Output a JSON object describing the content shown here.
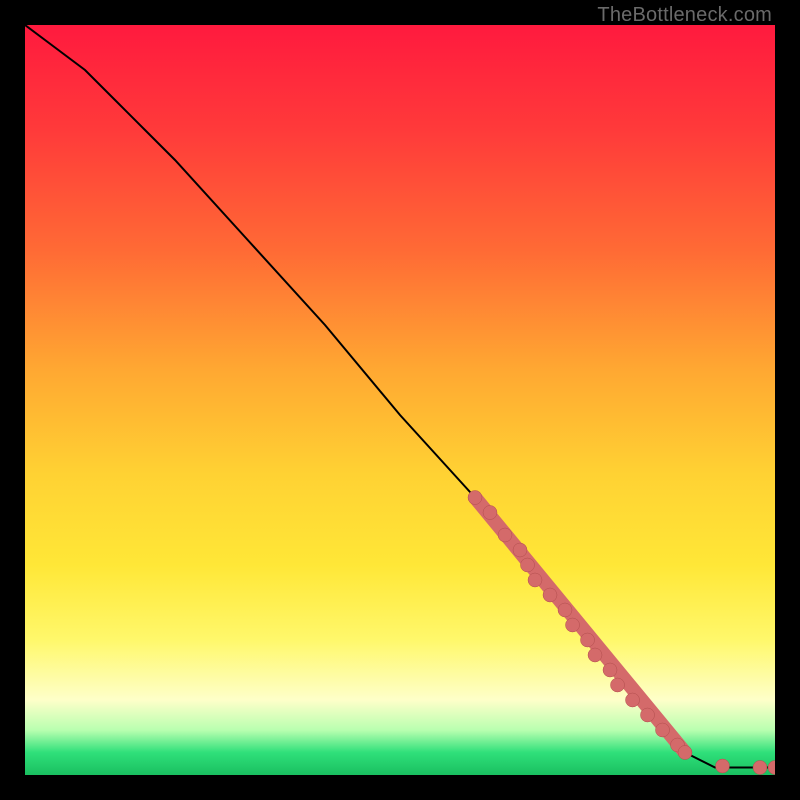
{
  "watermark": "TheBottleneck.com",
  "chart_data": {
    "type": "line",
    "title": "",
    "xlabel": "",
    "ylabel": "",
    "xlim": [
      0,
      100
    ],
    "ylim": [
      0,
      100
    ],
    "grid": false,
    "legend": false,
    "curve": {
      "x": [
        0,
        4,
        8,
        12,
        16,
        20,
        30,
        40,
        50,
        60,
        66,
        88,
        92,
        96,
        100
      ],
      "y": [
        100,
        97,
        94,
        90,
        86,
        82,
        71,
        60,
        48,
        37,
        30,
        3,
        1,
        1,
        1
      ]
    },
    "highlight_segment": {
      "note": "dense cluster of markers along the line where data is thick",
      "x_start": 60,
      "y_start": 37,
      "x_end": 88,
      "y_end": 3
    },
    "markers": [
      {
        "x": 60,
        "y": 37
      },
      {
        "x": 62,
        "y": 35
      },
      {
        "x": 64,
        "y": 32
      },
      {
        "x": 66,
        "y": 30
      },
      {
        "x": 67,
        "y": 28
      },
      {
        "x": 68,
        "y": 26
      },
      {
        "x": 70,
        "y": 24
      },
      {
        "x": 72,
        "y": 22
      },
      {
        "x": 73,
        "y": 20
      },
      {
        "x": 75,
        "y": 18
      },
      {
        "x": 76,
        "y": 16
      },
      {
        "x": 78,
        "y": 14
      },
      {
        "x": 79,
        "y": 12
      },
      {
        "x": 81,
        "y": 10
      },
      {
        "x": 83,
        "y": 8
      },
      {
        "x": 85,
        "y": 6
      },
      {
        "x": 87,
        "y": 4
      },
      {
        "x": 88,
        "y": 3
      },
      {
        "x": 93,
        "y": 1.2
      },
      {
        "x": 98,
        "y": 1.0
      },
      {
        "x": 100,
        "y": 1.0
      }
    ],
    "colors": {
      "curve": "#000000",
      "marker": "#d46a6a",
      "gradient_top": "#ff1a3e",
      "gradient_mid": "#ffe737",
      "gradient_bottom": "#1abf60"
    }
  }
}
